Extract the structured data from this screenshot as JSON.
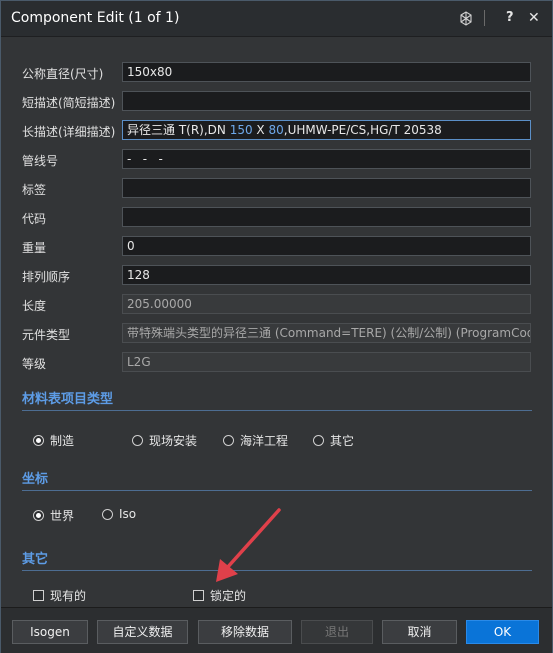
{
  "window": {
    "title": "Component Edit (1 of 1)",
    "help_label": "?",
    "close_label": "✕"
  },
  "fields": [
    {
      "label": "公称直径(尺寸)",
      "value": "150x80"
    },
    {
      "label": "短描述(简短描述)",
      "value": ""
    },
    {
      "label": "长描述(详细描述)",
      "value_parts": [
        "异径三通 T(R),DN ",
        "150",
        " X ",
        "80",
        ",UHMW-PE/CS,HG/T 20538"
      ]
    },
    {
      "label": "管线号",
      "value": "-   -   -"
    },
    {
      "label": "标签",
      "value": ""
    },
    {
      "label": "代码",
      "value": ""
    },
    {
      "label": "重量",
      "value": "0"
    },
    {
      "label": "排列顺序",
      "value": "128"
    },
    {
      "label": "长度",
      "value": "205.00000"
    },
    {
      "label": "元件类型",
      "value": "带特殊端头类型的异径三通 (Command=TERE) (公制/公制) (ProgramCode"
    },
    {
      "label": "等级",
      "value": "L2G"
    }
  ],
  "bom_section": {
    "title": "材料表项目类型",
    "options": [
      "制造",
      "现场安装",
      "海洋工程",
      "其它"
    ],
    "selected": "制造"
  },
  "coord_section": {
    "title": "坐标",
    "options": [
      "世界",
      "Iso"
    ],
    "selected": "世界"
  },
  "other_section": {
    "title": "其它",
    "checkboxes": [
      {
        "label": "现有的",
        "checked": false
      },
      {
        "label": "锁定的",
        "checked": false
      }
    ]
  },
  "footer": {
    "isogen": "Isogen",
    "custom_data": "自定义数据",
    "remove_data": "移除数据",
    "exit": "退出",
    "cancel": "取消",
    "ok": "OK"
  },
  "colors": {
    "accent": "#0a74d8",
    "section": "#5d9ce6",
    "annotation_arrow": "#e0404a"
  }
}
